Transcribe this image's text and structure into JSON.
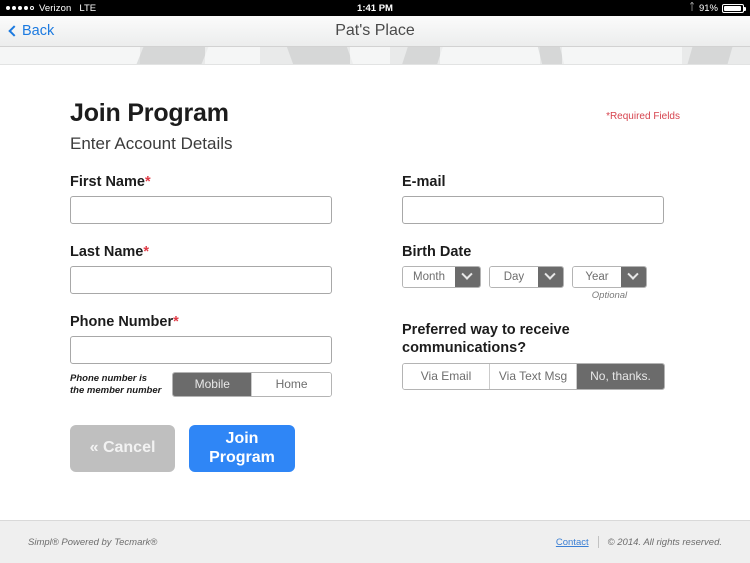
{
  "status_bar": {
    "carrier": "Verizon",
    "network": "LTE",
    "time": "1:41 PM",
    "battery_percent": "91%",
    "signal_bars_filled": 4,
    "signal_bars_total": 5,
    "bluetooth_icon": "bluetooth-icon"
  },
  "nav": {
    "back_label": "Back",
    "title": "Pat's Place"
  },
  "header": {
    "title": "Join Program",
    "subtitle": "Enter Account Details",
    "required_note": "*Required Fields"
  },
  "form": {
    "first_name": {
      "label": "First Name",
      "required_marker": "*",
      "value": "",
      "placeholder": ""
    },
    "last_name": {
      "label": "Last Name",
      "required_marker": "*",
      "value": "",
      "placeholder": ""
    },
    "phone_number": {
      "label": "Phone Number",
      "required_marker": "*",
      "value": "",
      "placeholder": "",
      "member_note": "Phone number is the member number",
      "options": [
        "Mobile",
        "Home"
      ],
      "selected": "Mobile"
    },
    "email": {
      "label": "E-mail",
      "value": "",
      "placeholder": ""
    },
    "birth_date": {
      "label": "Birth Date",
      "month": "Month",
      "day": "Day",
      "year": "Year",
      "optional_note": "Optional"
    },
    "communications": {
      "label": "Preferred way to receive communications?",
      "label_line1": "Preferred way to receive",
      "label_line2": "communications?",
      "options": [
        "Via Email",
        "Via Text Msg",
        "No, thanks."
      ],
      "selected": "No, thanks."
    }
  },
  "actions": {
    "cancel_label": "« Cancel",
    "join_line1": "Join",
    "join_line2": "Program"
  },
  "footer": {
    "branding": "Simpl® Powered by Tecmark®",
    "contact_label": "Contact",
    "copyright": "© 2014. All rights reserved."
  },
  "colors": {
    "accent_blue": "#2f86f6",
    "link_blue": "#1c7ae0",
    "required_red": "#d6434e",
    "segment_selected": "#6b6b6b",
    "cancel_gray": "#bfbfbf"
  }
}
